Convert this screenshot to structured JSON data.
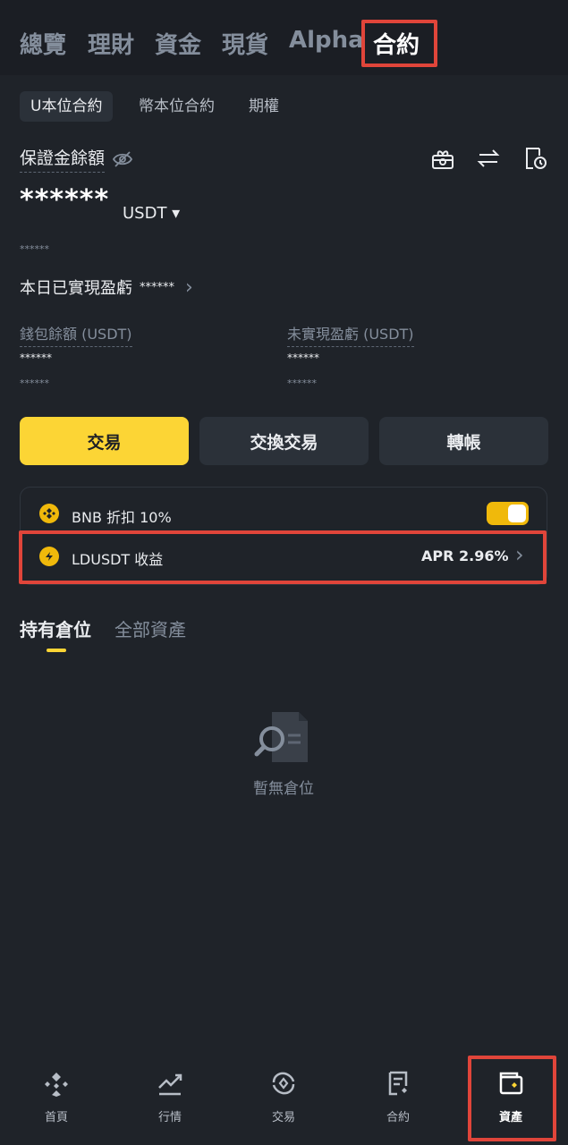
{
  "top_tabs": [
    "總覽",
    "理財",
    "資金",
    "現貨",
    "Alpha",
    "合約"
  ],
  "sub_tabs": [
    "U本位合約",
    "幣本位合約",
    "期權"
  ],
  "margin": {
    "label": "保證金餘額",
    "masked_value": "******",
    "currency": "USDT ▾",
    "masked_sub": "******"
  },
  "today_pnl": {
    "label": "本日已實現盈虧",
    "masked": "******",
    "arrow": "›"
  },
  "wallet": {
    "label": "錢包餘額 (USDT)",
    "masked": "******",
    "masked_sub": "******"
  },
  "unrealized": {
    "label": "未實現盈虧 (USDT)",
    "masked": "******",
    "masked_sub": "******"
  },
  "actions": {
    "trade": "交易",
    "swap": "交換交易",
    "transfer": "轉帳"
  },
  "bnb_discount": {
    "label": "BNB 折扣 10%",
    "enabled": true
  },
  "ldusdt": {
    "label": "LDUSDT 收益",
    "apr": "APR 2.96%",
    "arrow": "›"
  },
  "position_tabs": [
    "持有倉位",
    "全部資產"
  ],
  "empty_state": "暫無倉位",
  "bottom_nav": [
    "首頁",
    "行情",
    "交易",
    "合約",
    "資產"
  ],
  "colors": {
    "accent": "#fcd535",
    "background": "#1f2329",
    "highlight": "#e0453a"
  }
}
